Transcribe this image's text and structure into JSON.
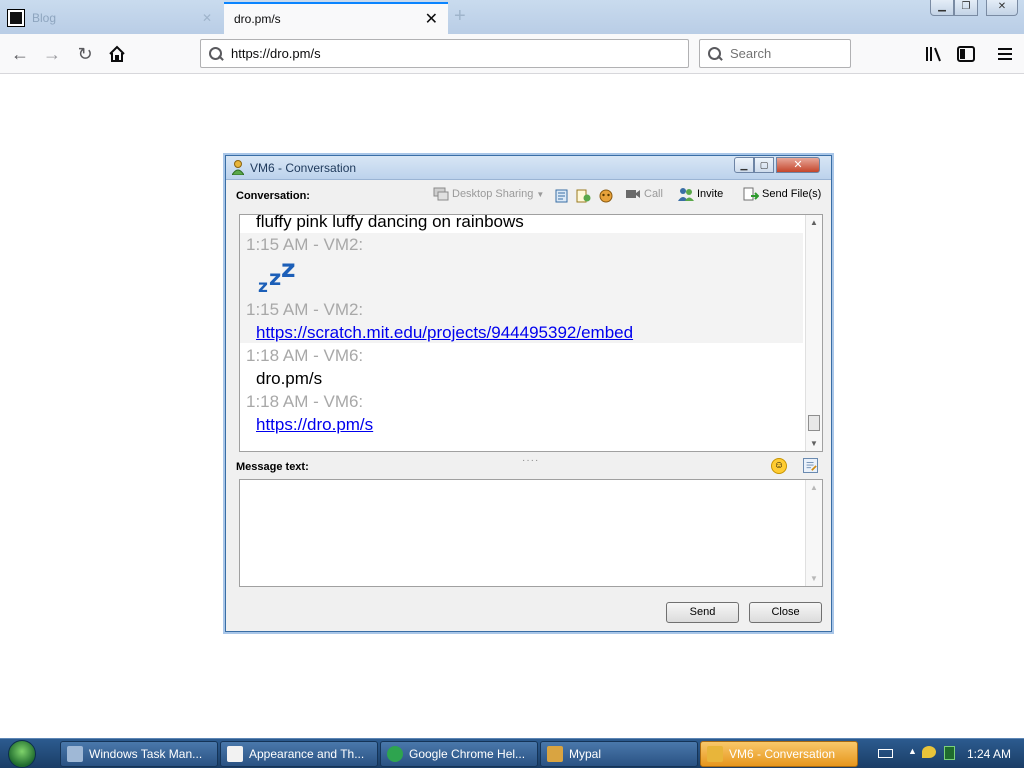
{
  "browser": {
    "tabs": [
      {
        "title": "Blog"
      },
      {
        "title": "dro.pm/s"
      }
    ],
    "new_tab_symbol": "+",
    "close_symbol": "✕",
    "url": "https://dro.pm/s",
    "search_placeholder": "Search"
  },
  "conversation_window": {
    "title": "VM6 - Conversation",
    "conversation_label": "Conversation:",
    "toolbar": {
      "desktop_sharing": "Desktop Sharing",
      "call": "Call",
      "invite": "Invite",
      "send_files": "Send File(s)"
    },
    "messages": [
      {
        "kind": "text",
        "text": "fluffy pink luffy dancing on rainbows"
      },
      {
        "kind": "meta",
        "text": "1:15 AM - VM2:"
      },
      {
        "kind": "meta",
        "text": "1:15 AM - VM2:"
      },
      {
        "kind": "link",
        "text": "https://scratch.mit.edu/projects/944495392/embed"
      },
      {
        "kind": "meta",
        "text": "1:18 AM - VM6:"
      },
      {
        "kind": "text",
        "text": "dro.pm/s"
      },
      {
        "kind": "meta",
        "text": "1:18 AM - VM6:"
      },
      {
        "kind": "link",
        "text": "https://dro.pm/s"
      }
    ],
    "message_label": "Message text:",
    "message_value": "",
    "buttons": {
      "send": "Send",
      "close": "Close"
    }
  },
  "taskbar": {
    "items": [
      {
        "label": "Windows Task Man...",
        "icon": "task-manager-icon",
        "color": "#9fb8d6"
      },
      {
        "label": "Appearance and Th...",
        "icon": "control-panel-icon",
        "color": "#f2f2f2"
      },
      {
        "label": "Google Chrome Hel...",
        "icon": "chrome-icon",
        "color": "#2ea44f"
      },
      {
        "label": "Mypal",
        "icon": "mypal-icon",
        "color": "#d9a441"
      },
      {
        "label": "VM6 - Conversation",
        "icon": "buddy-icon",
        "color": "#e8b53a",
        "active": true
      }
    ],
    "clock": "1:24 AM"
  },
  "colors": {
    "link": "#0000ee",
    "meta_text": "#a8a8a8",
    "firefox_accent": "#0a84ff"
  }
}
